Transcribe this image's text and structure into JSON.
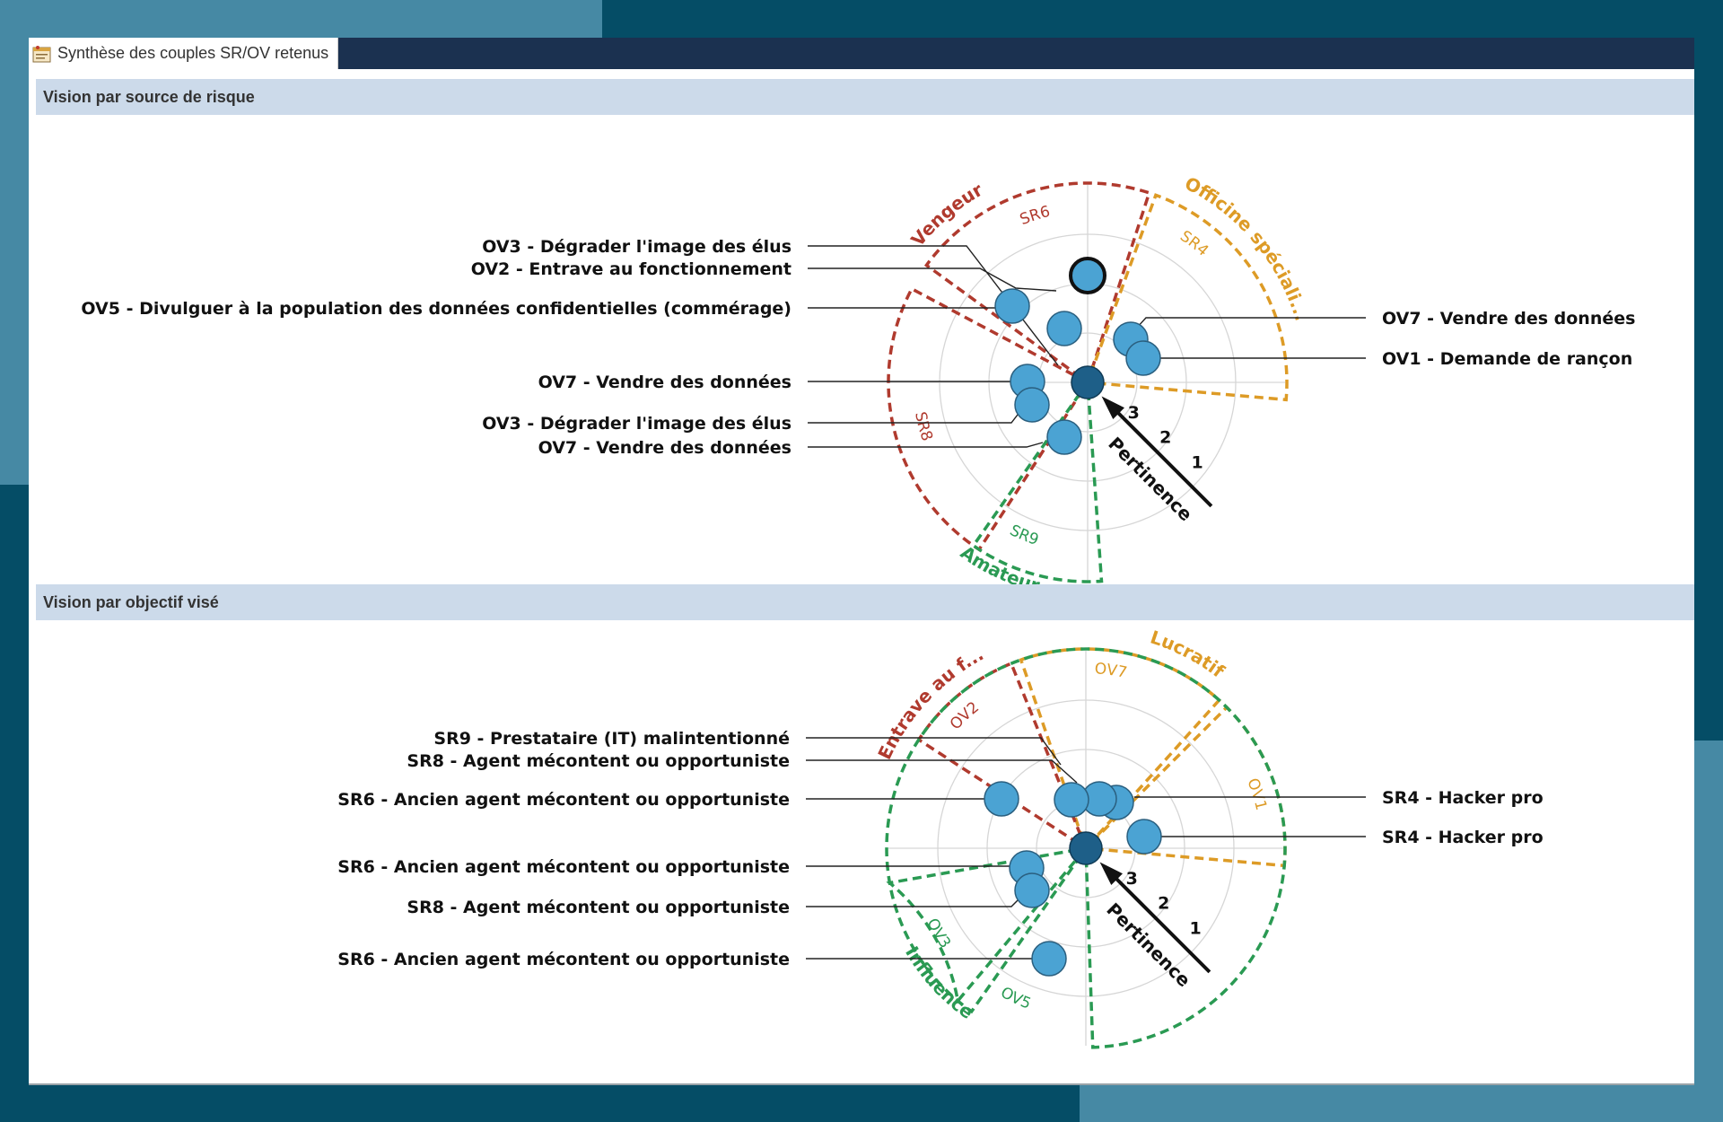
{
  "window": {
    "tab_label": "Synthèse des couples SR/OV retenus"
  },
  "colors": {
    "red": "#b03a2e",
    "orange": "#dd9b26",
    "green": "#2a9a53",
    "node": "#4ba3d3",
    "center": "#1e5f88"
  },
  "sections": [
    {
      "title": "Vision par source de risque",
      "axis_label": "Pertinence",
      "ring_labels": [
        "3",
        "2",
        "1"
      ],
      "sectors": [
        {
          "code": "SR6",
          "category": "Vengeur",
          "color": "red"
        },
        {
          "code": "SR4",
          "category": "Officine spéciali...",
          "color": "orange"
        },
        {
          "code": "SR8",
          "category": "",
          "color": "red"
        },
        {
          "code": "SR9",
          "category": "Amateur",
          "color": "green"
        }
      ],
      "labels_left": [
        "OV3 - Dégrader l'image des élus",
        "OV2 - Entrave au fonctionnement",
        "OV5 - Divulguer à la population des données confidentielles (commérage)",
        "OV7 - Vendre des données",
        "OV3 - Dégrader l'image des élus",
        "OV7 - Vendre des données"
      ],
      "labels_right": [
        "OV7 - Vendre des données",
        "OV1 - Demande de rançon"
      ]
    },
    {
      "title": "Vision par objectif visé",
      "axis_label": "Pertinence",
      "ring_labels": [
        "3",
        "2",
        "1"
      ],
      "sectors": [
        {
          "code": "OV7",
          "category": "Lucratif",
          "color": "orange"
        },
        {
          "code": "OV2",
          "category": "Entrave au f...",
          "color": "red"
        },
        {
          "code": "OV1",
          "category": "",
          "color": "orange"
        },
        {
          "code": "OV3",
          "category": "Influence",
          "color": "green"
        },
        {
          "code": "OV5",
          "category": "",
          "color": "green"
        }
      ],
      "labels_left": [
        "SR9 - Prestataire (IT) malintentionné",
        "SR8 - Agent mécontent ou opportuniste",
        "SR6 - Ancien agent mécontent ou opportuniste",
        "SR6 - Ancien agent mécontent ou opportuniste",
        "SR8 - Agent mécontent ou opportuniste",
        "SR6 - Ancien agent mécontent ou opportuniste"
      ],
      "labels_right": [
        "SR4 - Hacker pro",
        "SR4 - Hacker pro"
      ]
    }
  ]
}
